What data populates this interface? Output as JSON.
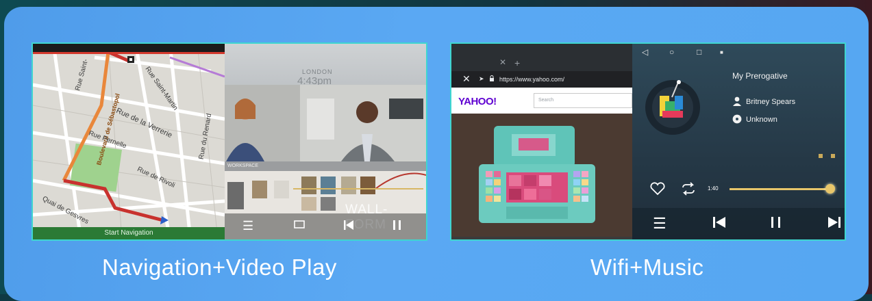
{
  "captions": {
    "left": "Navigation+Video Play",
    "right": "Wifi+Music"
  },
  "map": {
    "streets": [
      "Rue Saint-",
      "Boulevard de Sébastopol",
      "Rue Saint-Martin",
      "Rue de la Verrerie",
      "Rue Pernelle",
      "Rue du Renard",
      "Rue de Rivoli",
      "Quai de Gesvres"
    ],
    "button_label": "Start Navigation",
    "route_color": "#c8322e"
  },
  "video": {
    "city": "LONDON",
    "time": "4:43pm",
    "strip_label": "WORKSPACE",
    "overlay_text": "WALL-FORM",
    "controls": [
      "list-icon",
      "fullscreen-icon",
      "previous-icon",
      "pause-icon"
    ]
  },
  "browser": {
    "url": "https://www.yahoo.com/",
    "logo": "YAHOO!",
    "search_placeholder": "Search"
  },
  "music": {
    "song_title": "My Prerogative",
    "artist": "Britney Spears",
    "album": "Unknown",
    "elapsed": "1:40",
    "progress": 0.97,
    "accent_color": "#e8c66a",
    "system_icons": [
      "back-icon",
      "home-icon",
      "recents-icon",
      "notification-icon"
    ]
  }
}
